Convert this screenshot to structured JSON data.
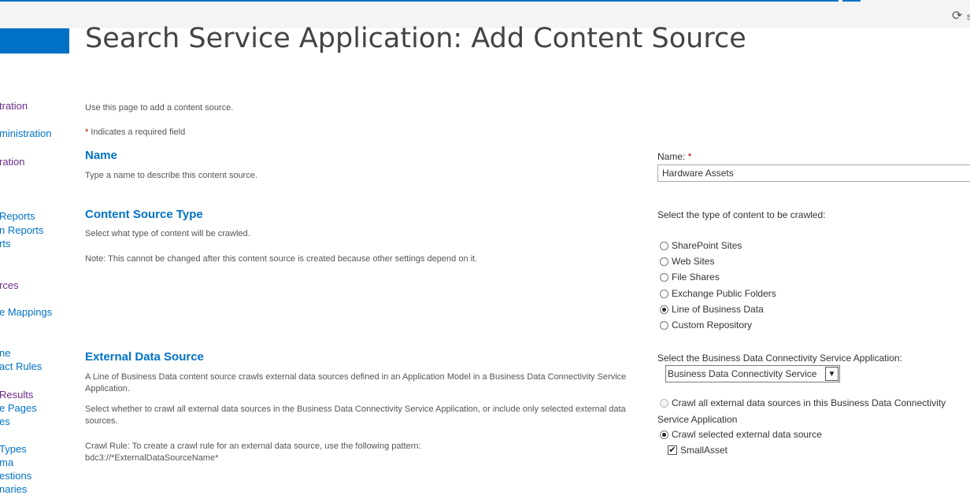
{
  "header": {
    "sync_icon": "sync-icon",
    "sync_label": "s"
  },
  "page_title": "Search Service Application: Add Content Source",
  "quick_nav": [
    {
      "label": "tration",
      "visited": true
    },
    {
      "label": "ministration",
      "visited": false
    },
    {
      "label": "ration",
      "visited": true
    },
    {
      "label": " Reports",
      "visited": false
    },
    {
      "label": "n Reports",
      "visited": false
    },
    {
      "label": "rts",
      "visited": false
    },
    {
      "label": "rces",
      "visited": true
    },
    {
      "label": "e Mappings",
      "visited": false
    },
    {
      "label": "ne",
      "visited": false
    },
    {
      "label": "act Rules",
      "visited": false
    },
    {
      "label": " Results",
      "visited": true
    },
    {
      "label": "e Pages",
      "visited": false
    },
    {
      "label": "es",
      "visited": false
    },
    {
      "label": " Types",
      "visited": false
    },
    {
      "label": "ma",
      "visited": false
    },
    {
      "label": "estions",
      "visited": false
    },
    {
      "label": "naries",
      "visited": false
    }
  ],
  "intro": {
    "description": "Use this page to add a content source.",
    "required_marker": "*",
    "required_text": "Indicates a required field"
  },
  "name_section": {
    "title": "Name",
    "description": "Type a name to describe this content source.",
    "field_label": "Name:",
    "required_marker": "*",
    "value": "Hardware Assets"
  },
  "type_section": {
    "title": "Content Source Type",
    "description": "Select what type of content will be crawled.",
    "note": "Note: This cannot be changed after this content source is created because other settings depend on it.",
    "prompt": "Select the type of content to be crawled:",
    "options": [
      {
        "label": "SharePoint Sites",
        "checked": false
      },
      {
        "label": "Web Sites",
        "checked": false
      },
      {
        "label": "File Shares",
        "checked": false
      },
      {
        "label": "Exchange Public Folders",
        "checked": false
      },
      {
        "label": "Line of Business Data",
        "checked": true
      },
      {
        "label": "Custom Repository",
        "checked": false
      }
    ]
  },
  "external_section": {
    "title": "External Data Source",
    "description1": "A Line of Business Data content source crawls external data sources defined in an Application Model in a Business Data Connectivity Service Application.",
    "description2": "Select whether to crawl all external data sources in the Business Data Connectivity Service Application, or include only selected external data sources.",
    "crawl_rule_line1": "Crawl Rule: To create a crawl rule for an external data source, use the following pattern:",
    "crawl_rule_line2": "bdc3://*ExternalDataSourceName*",
    "select_prompt": "Select the Business Data Connectivity Service Application:",
    "selected_app": "Business Data Connectivity Service",
    "crawl_all_label_1": "Crawl all external data sources in this Business Data Connectivity",
    "crawl_all_label_2": "Service Application",
    "crawl_selected_label": "Crawl selected external data source",
    "sources": [
      {
        "label": "SmallAsset",
        "checked": true
      }
    ]
  }
}
